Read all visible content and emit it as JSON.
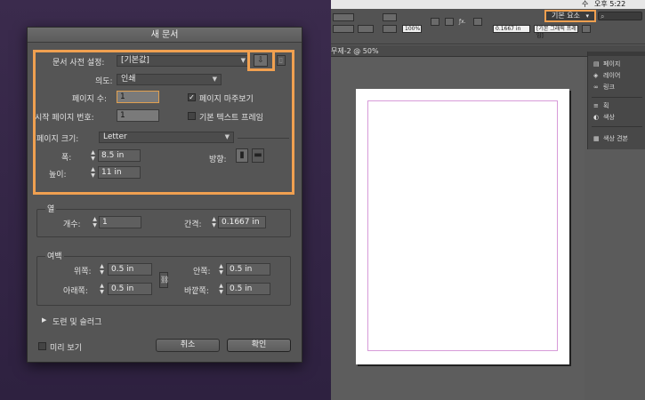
{
  "app": {
    "menubar": {
      "right_a": "수",
      "clock": "오후 5:22"
    },
    "workspace_label": "기본 요소",
    "workspace_arrow": "▾",
    "search_icon": "⌕",
    "controlbar": {
      "stroke": "0.1667 in",
      "frame": "[기본 그래픽 프레임]",
      "zoom": "100%"
    },
    "doc_tab": "무제-2 @ 50%",
    "panel_items": [
      {
        "icon": "▤",
        "label": "페이지"
      },
      {
        "icon": "◈",
        "label": "레이어"
      },
      {
        "icon": "∞",
        "label": "링크"
      },
      {
        "icon": "≡",
        "label": "획"
      },
      {
        "icon": "◐",
        "label": "색상"
      },
      {
        "icon": "▦",
        "label": "색상 견본"
      }
    ]
  },
  "dialog": {
    "title": "새 문서",
    "preset_label": "문서 사전 설정:",
    "preset_value": "[기본값]",
    "intent_label": "의도:",
    "intent_value": "인쇄",
    "pages_label": "페이지 수:",
    "pages_value": "1",
    "facing_label": "페이지 마주보기",
    "facing_checked": "✓",
    "start_page_label": "시작 페이지 번호:",
    "start_page_value": "1",
    "primary_text_label": "기본 텍스트 프레임",
    "page_size_label": "페이지 크기:",
    "page_size_value": "Letter",
    "width_label": "폭:",
    "width_value": "8.5 in",
    "height_label": "높이:",
    "height_value": "11 in",
    "orientation_label": "방향:",
    "columns_group": "열",
    "col_count_label": "개수:",
    "col_count_value": "1",
    "gutter_label": "간격:",
    "gutter_value": "0.1667 in",
    "margins_group": "여백",
    "top_label": "위쪽:",
    "top_value": "0.5 in",
    "bottom_label": "아래쪽:",
    "bottom_value": "0.5 in",
    "inside_label": "안쪽:",
    "inside_value": "0.5 in",
    "outside_label": "바깥쪽:",
    "outside_value": "0.5 in",
    "bleed_label": "도련 및 슬러그",
    "preview_label": "미리 보기",
    "cancel_label": "취소",
    "ok_label": "확인",
    "highlight_color": "#f0a050"
  }
}
